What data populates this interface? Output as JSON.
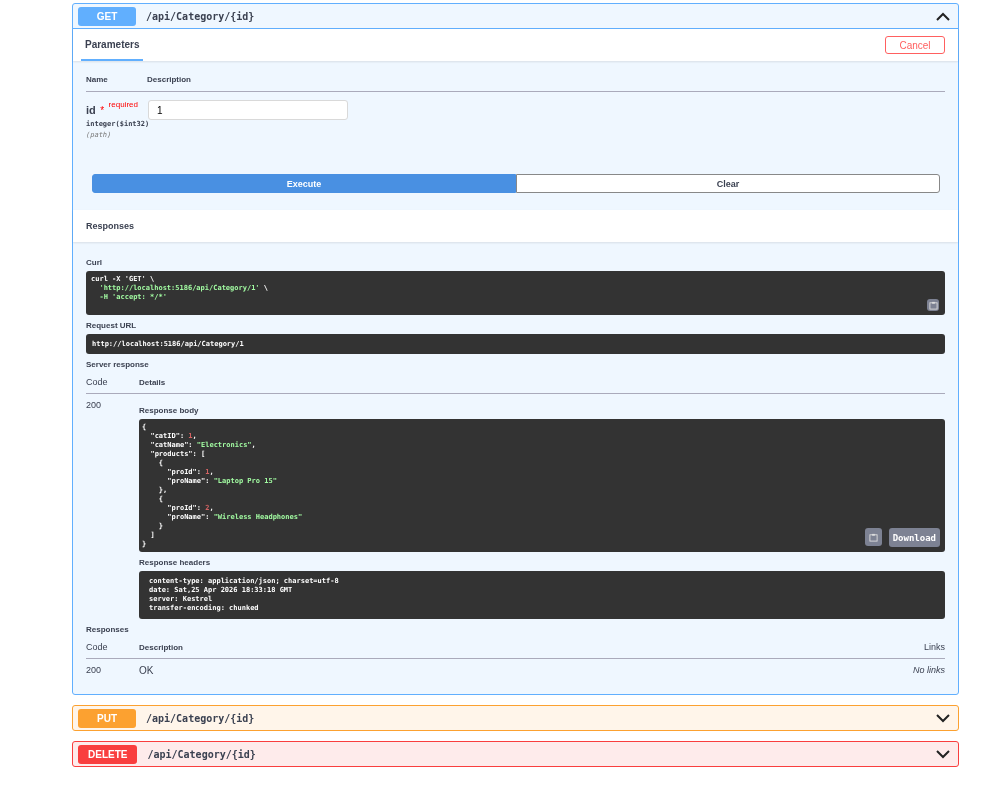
{
  "operations": [
    {
      "method": "GET",
      "path": "/api/Category/{id}",
      "color": "#61affe",
      "expanded": true
    },
    {
      "method": "PUT",
      "path": "/api/Category/{id}",
      "color": "#fca130",
      "expanded": false
    },
    {
      "method": "DELETE",
      "path": "/api/Category/{id}",
      "color": "#f93e3e",
      "expanded": false
    }
  ],
  "tabs": [
    {
      "label": "Parameters",
      "selected": true
    }
  ],
  "cancel_button": "Cancel",
  "param_columns": [
    "Name",
    "Description"
  ],
  "parameter": {
    "name": "id",
    "star": "*",
    "required": "required",
    "type": "integer($int32)",
    "location": "(path)",
    "value": "1"
  },
  "execute_button": "Execute",
  "clear_button": "Clear",
  "responses_heading": "Responses",
  "curl": {
    "label": "Curl",
    "lines": [
      [
        {
          "kind": "plain",
          "s": "curl -X 'GET' \\"
        }
      ],
      [
        {
          "kind": "str",
          "s": "  'http://localhost:5186/api/Category/1'"
        },
        {
          "kind": "plain",
          "s": " \\"
        }
      ],
      [
        {
          "kind": "str",
          "s": "  -H 'accept: */*'"
        }
      ]
    ]
  },
  "request_url": {
    "label": "Request URL",
    "value": "http://localhost:5186/api/Category/1"
  },
  "server_response": {
    "label": "Server response",
    "columns": [
      "Code",
      "Details"
    ],
    "code": "200",
    "body_label": "Response body",
    "body_lines": [
      [
        {
          "kind": "plain",
          "s": "{"
        }
      ],
      [
        {
          "kind": "plain",
          "s": "  \"catID\": "
        },
        {
          "kind": "num",
          "s": "1"
        },
        {
          "kind": "plain",
          "s": ","
        }
      ],
      [
        {
          "kind": "plain",
          "s": "  \"catName\": "
        },
        {
          "kind": "str",
          "s": "\"Electronics\""
        },
        {
          "kind": "plain",
          "s": ","
        }
      ],
      [
        {
          "kind": "plain",
          "s": "  \"products\": ["
        }
      ],
      [
        {
          "kind": "plain",
          "s": "    {"
        }
      ],
      [
        {
          "kind": "plain",
          "s": "      \"proId\": "
        },
        {
          "kind": "num",
          "s": "1"
        },
        {
          "kind": "plain",
          "s": ","
        }
      ],
      [
        {
          "kind": "plain",
          "s": "      \"proName\": "
        },
        {
          "kind": "str",
          "s": "\"Laptop Pro 15\""
        }
      ],
      [
        {
          "kind": "plain",
          "s": "    },"
        }
      ],
      [
        {
          "kind": "plain",
          "s": "    {"
        }
      ],
      [
        {
          "kind": "plain",
          "s": "      \"proId\": "
        },
        {
          "kind": "num",
          "s": "2"
        },
        {
          "kind": "plain",
          "s": ","
        }
      ],
      [
        {
          "kind": "plain",
          "s": "      \"proName\": "
        },
        {
          "kind": "str",
          "s": "\"Wireless Headphones\""
        }
      ],
      [
        {
          "kind": "plain",
          "s": "    }"
        }
      ],
      [
        {
          "kind": "plain",
          "s": "  ]"
        }
      ],
      [
        {
          "kind": "plain",
          "s": "}"
        }
      ]
    ],
    "download_button": "Download",
    "headers_label": "Response headers",
    "header_lines": [
      "content-type: application/json; charset=utf-8",
      "date: Sat,25 Apr 2026 18:33:18 GMT",
      "server: Kestrel",
      "transfer-encoding: chunked"
    ]
  },
  "responses": {
    "label": "Responses",
    "columns": [
      "Code",
      "Description",
      "Links"
    ],
    "rows": [
      {
        "code": "200",
        "description": "OK",
        "links": "No links"
      }
    ]
  }
}
